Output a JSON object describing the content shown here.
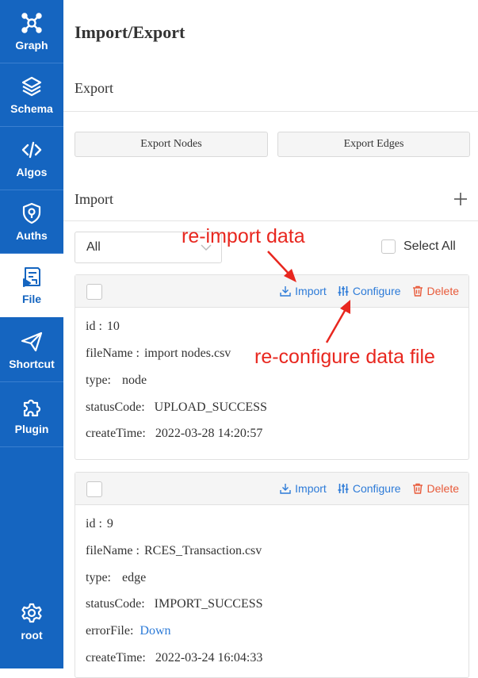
{
  "sidebar": {
    "items": [
      {
        "label": "Graph",
        "icon": "graph-icon"
      },
      {
        "label": "Schema",
        "icon": "layers-icon"
      },
      {
        "label": "Algos",
        "icon": "code-icon"
      },
      {
        "label": "Auths",
        "icon": "shield-icon"
      },
      {
        "label": "File",
        "icon": "file-icon",
        "active": true
      },
      {
        "label": "Shortcut",
        "icon": "send-icon"
      },
      {
        "label": "Plugin",
        "icon": "puzzle-icon"
      }
    ],
    "user": {
      "label": "root",
      "icon": "gear-icon"
    }
  },
  "page": {
    "title": "Import/Export"
  },
  "export": {
    "title": "Export",
    "nodes_button": "Export Nodes",
    "edges_button": "Export Edges"
  },
  "import": {
    "title": "Import",
    "filter": {
      "selected": "All"
    },
    "select_all": "Select All"
  },
  "actions": {
    "import": "Import",
    "configure": "Configure",
    "delete": "Delete"
  },
  "files": [
    {
      "id_label": "id :",
      "id": "10",
      "filename_label": "fileName :",
      "filename": "import nodes.csv",
      "type_label": "type:",
      "type": "node",
      "status_label": "statusCode:",
      "status": "UPLOAD_SUCCESS",
      "created_label": "createTime:",
      "created": "2022-03-28 14:20:57"
    },
    {
      "id_label": "id :",
      "id": "9",
      "filename_label": "fileName :",
      "filename": "RCES_Transaction.csv",
      "type_label": "type:",
      "type": "edge",
      "status_label": "statusCode:",
      "status": "IMPORT_SUCCESS",
      "errorfile_label": "errorFile:",
      "errorfile_link": "Down",
      "created_label": "createTime:",
      "created": "2022-03-24 16:04:33"
    }
  ],
  "annotations": {
    "reimport": "re-import data",
    "reconfigure": "re-configure data file"
  },
  "colors": {
    "sidebar": "#1565c0",
    "link": "#2d7bd8",
    "danger": "#e85a3a",
    "annotation": "#e8271f"
  }
}
